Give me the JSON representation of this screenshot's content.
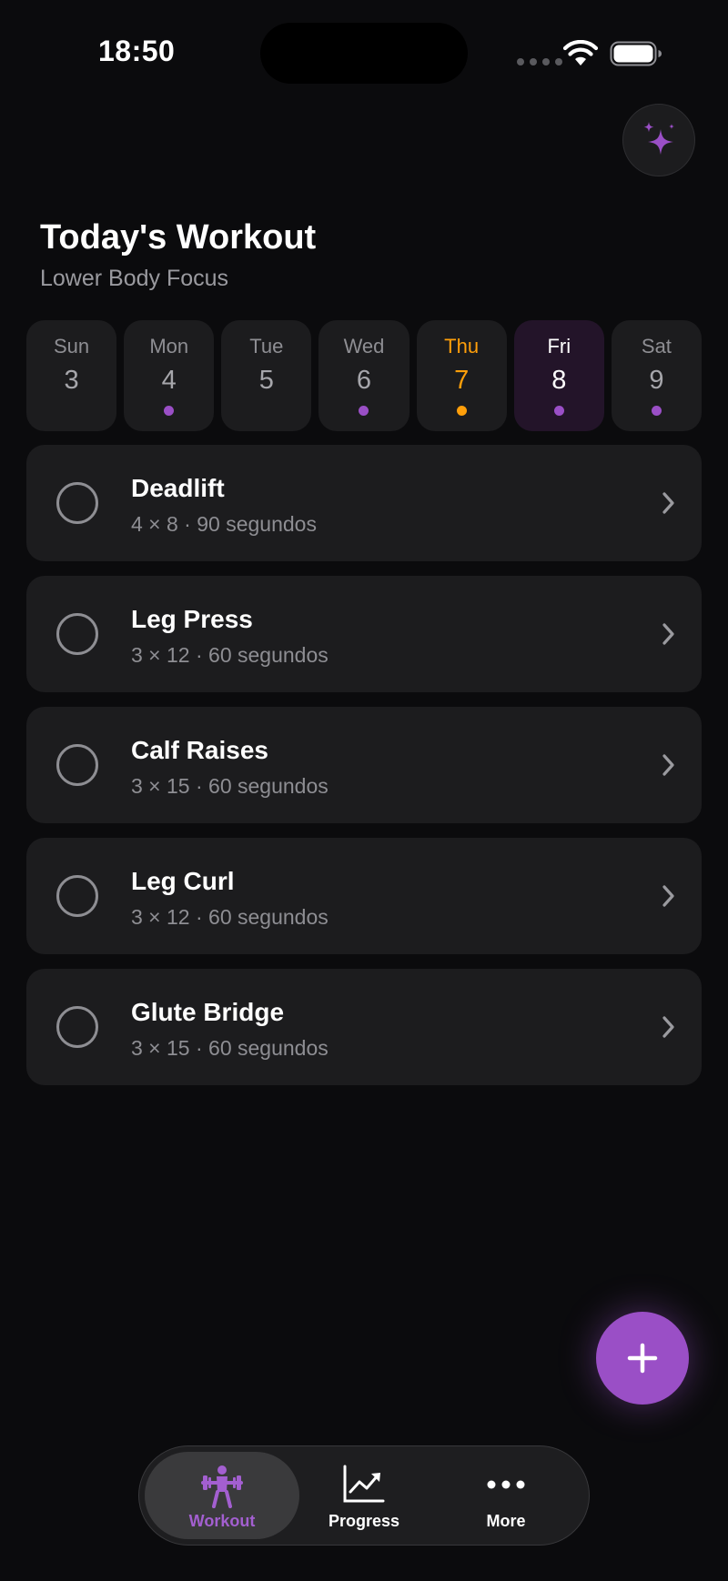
{
  "status_bar": {
    "time": "18:50"
  },
  "header": {
    "title": "Today's Workout",
    "subtitle": "Lower Body Focus"
  },
  "week": [
    {
      "day": "Sun",
      "date": "3",
      "has_workout": false,
      "is_today": false,
      "is_selected": false
    },
    {
      "day": "Mon",
      "date": "4",
      "has_workout": true,
      "is_today": false,
      "is_selected": false
    },
    {
      "day": "Tue",
      "date": "5",
      "has_workout": false,
      "is_today": false,
      "is_selected": false
    },
    {
      "day": "Wed",
      "date": "6",
      "has_workout": true,
      "is_today": false,
      "is_selected": false
    },
    {
      "day": "Thu",
      "date": "7",
      "has_workout": true,
      "is_today": true,
      "is_selected": false
    },
    {
      "day": "Fri",
      "date": "8",
      "has_workout": true,
      "is_today": false,
      "is_selected": true
    },
    {
      "day": "Sat",
      "date": "9",
      "has_workout": true,
      "is_today": false,
      "is_selected": false
    }
  ],
  "exercises": [
    {
      "name": "Deadlift",
      "detail": "4 × 8 · 90 segundos",
      "completed": false
    },
    {
      "name": "Leg Press",
      "detail": "3 × 12 · 60 segundos",
      "completed": false
    },
    {
      "name": "Calf Raises",
      "detail": "3 × 15 · 60 segundos",
      "completed": false
    },
    {
      "name": "Leg Curl",
      "detail": "3 × 12 · 60 segundos",
      "completed": false
    },
    {
      "name": "Glute Bridge",
      "detail": "3 × 15 · 60 segundos",
      "completed": false
    }
  ],
  "tabs": [
    {
      "label": "Workout",
      "icon": "weightlifter-icon",
      "active": true
    },
    {
      "label": "Progress",
      "icon": "chart-trend-icon",
      "active": false
    },
    {
      "label": "More",
      "icon": "more-dots-icon",
      "active": false
    }
  ],
  "icons": {
    "ai_button": "sparkles-icon",
    "fab": "plus-icon"
  },
  "colors": {
    "background": "#0b0b0d",
    "card": "#1c1c1e",
    "accent_purple": "#9a4fc6",
    "today_orange": "#ff9f0a",
    "muted_text": "#8e8e93"
  }
}
